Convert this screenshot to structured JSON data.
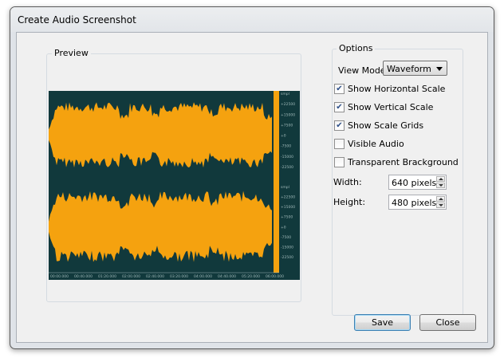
{
  "window": {
    "title": "Create Audio Screenshot"
  },
  "preview": {
    "label": "Preview"
  },
  "waveform": {
    "colors": {
      "background": "#11393c",
      "wave": "#f5a20f",
      "scale_text": "#9fb8b8"
    },
    "channel1_scale": [
      "smpl",
      "+22500",
      "+15000",
      "+7500",
      "+0",
      "-7500",
      "-15000",
      "-22500"
    ],
    "channel2_scale": [
      "smpl",
      "+22500",
      "+15000",
      "+7500",
      "+0",
      "-7500",
      "-15000",
      "-22500"
    ],
    "time_labels": [
      "00:00.000",
      "00:40.000",
      "01:20.000",
      "02:00.000",
      "02:40.000",
      "03:20.000",
      "04:00.000",
      "04:40.000",
      "05:20.000",
      "06:00.000"
    ]
  },
  "options": {
    "group_label": "Options",
    "view_mode_label": "View Mode:",
    "view_mode_value": "Waveform",
    "checkboxes": [
      {
        "label": "Show Horizontal Scale",
        "checked": true
      },
      {
        "label": "Show Vertical Scale",
        "checked": true
      },
      {
        "label": "Show Scale Grids",
        "checked": true
      },
      {
        "label": "Visible Audio",
        "checked": false
      },
      {
        "label": "Transparent Brackground",
        "checked": false
      }
    ],
    "width_label": "Width:",
    "width_value": "640 pixels",
    "height_label": "Height:",
    "height_value": "480 pixels"
  },
  "buttons": {
    "save": "Save",
    "close": "Close"
  }
}
